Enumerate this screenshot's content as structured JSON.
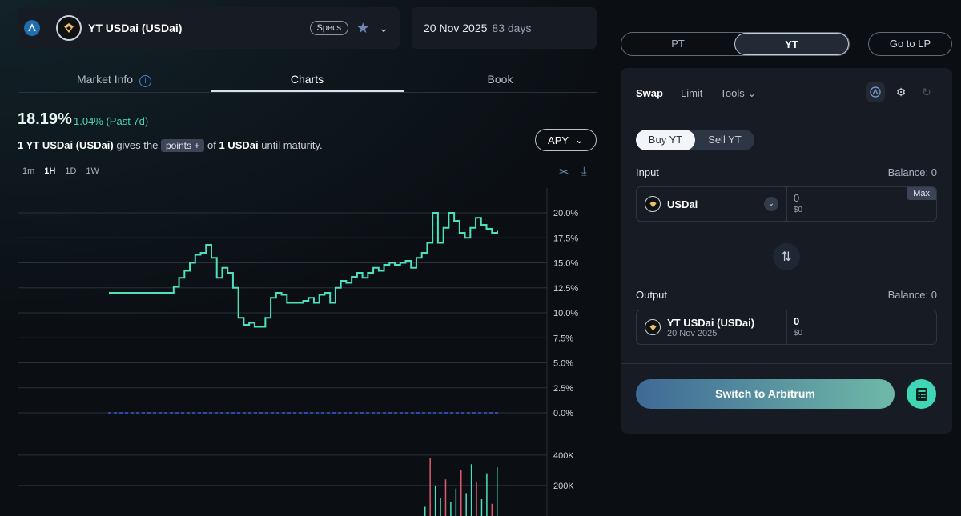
{
  "market": {
    "name": "YT USDai (USDai)",
    "specs_label": "Specs",
    "maturity_date": "20 Nov 2025",
    "days_left": "83 days"
  },
  "tabs": [
    {
      "label": "Market Info"
    },
    {
      "label": "Charts"
    },
    {
      "label": "Book"
    }
  ],
  "chart_header": {
    "apy_value": "18.19%",
    "apy_change": "1.04% (Past 7d)",
    "desc_prefix": "1 YT USDai (USDai)",
    "desc_gives": "gives the",
    "points_label": "points",
    "desc_of": "of",
    "desc_token": "1 USDai",
    "desc_suffix": "until maturity.",
    "metric_select": "APY",
    "timeframes": [
      "1m",
      "1H",
      "1D",
      "1W"
    ],
    "active_timeframe": "1H"
  },
  "chart_data": {
    "type": "line",
    "y_ticks": [
      "20.0%",
      "17.5%",
      "15.0%",
      "12.5%",
      "10.0%",
      "7.5%",
      "5.0%",
      "2.5%",
      "0.0%"
    ],
    "ylim": [
      0,
      20
    ],
    "series": [
      {
        "values": [
          12,
          12,
          12,
          12,
          12,
          12,
          12,
          12,
          12,
          12,
          12,
          12,
          12.6,
          13.5,
          14.2,
          15.0,
          15.8,
          16.0,
          16.8,
          15.5,
          13.5,
          14.5,
          14.0,
          12.5,
          9.5,
          8.8,
          9.0,
          8.6,
          8.6,
          9.5,
          11.5,
          12.0,
          11.8,
          11.0,
          11.0,
          11.0,
          11.2,
          11.5,
          11.0,
          11.8,
          12.0,
          11.0,
          12.5,
          13.2,
          13.0,
          13.6,
          14.0,
          13.5,
          14.0,
          14.5,
          14.2,
          14.8,
          15.0,
          14.8,
          15.0,
          15.2,
          14.5,
          15.5,
          16.0,
          17.0,
          20.0,
          17.0,
          18.5,
          20.0,
          19.2,
          18.0,
          17.5,
          18.5,
          19.5,
          18.8,
          18.4,
          18.0,
          18.19
        ]
      }
    ],
    "zero_line": 0,
    "volume_ticks": [
      "400K",
      "200K"
    ],
    "volume_ylim": [
      0,
      500000
    ],
    "volume_values": [
      60000,
      380000,
      200000,
      120000,
      240000,
      90000,
      180000,
      300000,
      150000,
      340000,
      220000,
      110000,
      280000,
      80000,
      320000
    ]
  },
  "right_panel": {
    "pt_label": "PT",
    "yt_label": "YT",
    "go_lp_label": "Go to LP",
    "tabs": [
      "Swap",
      "Limit",
      "Tools"
    ],
    "buy_label": "Buy YT",
    "sell_label": "Sell YT",
    "input_label": "Input",
    "input_balance": "Balance: 0",
    "input_token": "USDai",
    "input_amount": "0",
    "input_usd": "$0",
    "max_label": "Max",
    "output_label": "Output",
    "output_balance": "Balance: 0",
    "output_token": "YT USDai (USDai)",
    "output_token_date": "20 Nov 2025",
    "output_amount": "0",
    "output_usd": "$0",
    "switch_label": "Switch to Arbitrum"
  },
  "colors": {
    "accent": "#3fd6b5",
    "line": "#4de0bd",
    "zero_line": "#3b5bd9"
  }
}
